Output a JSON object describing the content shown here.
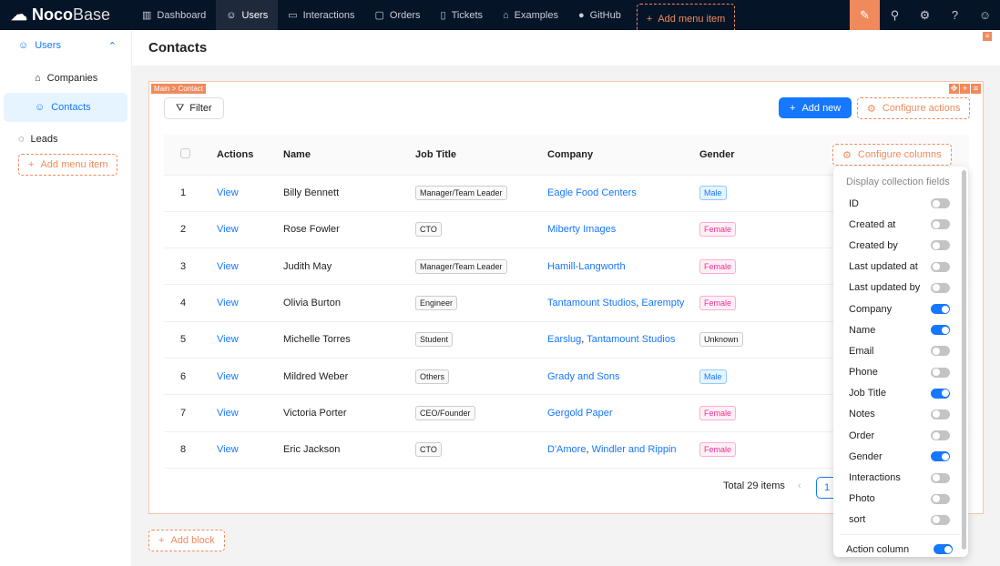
{
  "app": {
    "logo_bold": "Noco",
    "logo_light": "Base"
  },
  "topnav": [
    {
      "label": "Dashboard",
      "icon": "▥"
    },
    {
      "label": "Users",
      "icon": "☺"
    },
    {
      "label": "Interactions",
      "icon": "▭"
    },
    {
      "label": "Orders",
      "icon": "▢"
    },
    {
      "label": "Tickets",
      "icon": "▯"
    },
    {
      "label": "Examples",
      "icon": "⌂"
    },
    {
      "label": "GitHub",
      "icon": "●"
    }
  ],
  "add_menu_item": "Add menu item",
  "sidebar": {
    "group": "Users",
    "items": [
      {
        "label": "Companies",
        "icon": "⌂"
      },
      {
        "label": "Contacts",
        "icon": "☺"
      }
    ],
    "leads": "Leads",
    "add_menu_item": "Add menu item"
  },
  "page_title": "Contacts",
  "block": {
    "breadcrumb": "Main > Contact",
    "filter": "Filter",
    "add_new": "Add new",
    "configure_actions": "Configure actions",
    "configure_columns": "Configure columns"
  },
  "table": {
    "headers": [
      "Actions",
      "Name",
      "Job Title",
      "Company",
      "Gender"
    ],
    "rows": [
      {
        "n": "1",
        "action": "View",
        "name": "Billy Bennett",
        "job": "Manager/Team Leader",
        "company": "Eagle Food Centers",
        "gender": "Male"
      },
      {
        "n": "2",
        "action": "View",
        "name": "Rose Fowler",
        "job": "CTO",
        "company": "Miberty Images",
        "gender": "Female"
      },
      {
        "n": "3",
        "action": "View",
        "name": "Judith May",
        "job": "Manager/Team Leader",
        "company": "Hamill-Langworth",
        "gender": "Female"
      },
      {
        "n": "4",
        "action": "View",
        "name": "Olivia Burton",
        "job": "Engineer",
        "company": "Tantamount Studios, Earempty",
        "gender": "Female"
      },
      {
        "n": "5",
        "action": "View",
        "name": "Michelle Torres",
        "job": "Student",
        "company": "Earslug, Tantamount Studios",
        "gender": "Unknown"
      },
      {
        "n": "6",
        "action": "View",
        "name": "Mildred Weber",
        "job": "Others",
        "company": "Grady and Sons",
        "gender": "Male"
      },
      {
        "n": "7",
        "action": "View",
        "name": "Victoria Porter",
        "job": "CEO/Founder",
        "company": "Gergold Paper",
        "gender": "Female"
      },
      {
        "n": "8",
        "action": "View",
        "name": "Eric Jackson",
        "job": "CTO",
        "company": "D'Amore, Windler and Rippin",
        "gender": "Female"
      }
    ]
  },
  "pagination": {
    "total": "Total 29 items",
    "current": "1"
  },
  "dropdown": {
    "title": "Display collection fields",
    "fields": [
      {
        "label": "ID",
        "on": false
      },
      {
        "label": "Created at",
        "on": false
      },
      {
        "label": "Created by",
        "on": false
      },
      {
        "label": "Last updated at",
        "on": false
      },
      {
        "label": "Last updated by",
        "on": false
      },
      {
        "label": "Company",
        "on": true
      },
      {
        "label": "Name",
        "on": true
      },
      {
        "label": "Email",
        "on": false
      },
      {
        "label": "Phone",
        "on": false
      },
      {
        "label": "Job Title",
        "on": true
      },
      {
        "label": "Notes",
        "on": false
      },
      {
        "label": "Order",
        "on": false
      },
      {
        "label": "Gender",
        "on": true
      },
      {
        "label": "Interactions",
        "on": false
      },
      {
        "label": "Photo",
        "on": false
      },
      {
        "label": "sort",
        "on": false
      }
    ],
    "action_column": {
      "label": "Action column",
      "on": true
    }
  },
  "add_block": "Add block"
}
